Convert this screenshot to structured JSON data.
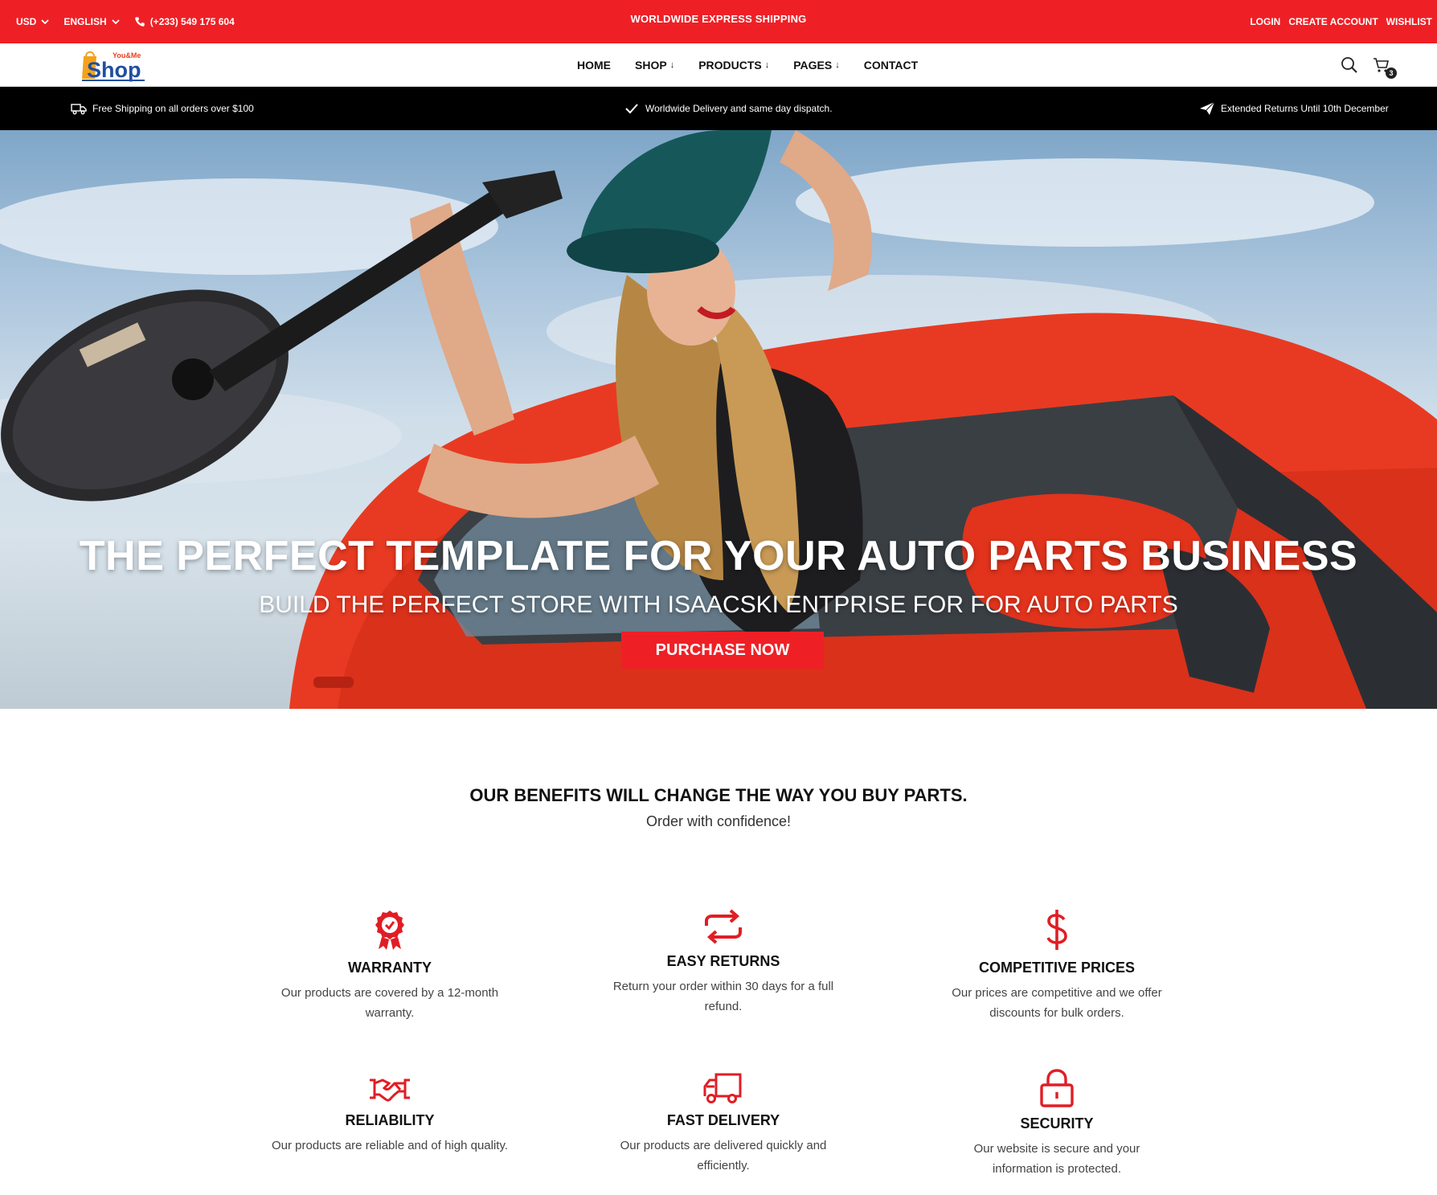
{
  "topbar": {
    "currency": "USD",
    "language": "ENGLISH",
    "phone": "(+233) 549 175 604",
    "announcement": "WORLDWIDE EXPRESS SHIPPING",
    "links": {
      "login": "LOGIN",
      "create_account": "CREATE ACCOUNT",
      "wishlist": "WISHLIST"
    }
  },
  "logo": {
    "top": "You&Me",
    "main": "Shop"
  },
  "nav": {
    "home": "HOME",
    "shop": "SHOP",
    "products": "PRODUCTS",
    "pages": "PAGES",
    "contact": "CONTACT",
    "arrow": "↓",
    "cart_count": "3"
  },
  "infobar": {
    "shipping": "Free Shipping on all orders over $100",
    "delivery": "Worldwide Delivery and same day dispatch.",
    "returns": "Extended Returns Until 10th December"
  },
  "hero": {
    "title": "THE PERFECT TEMPLATE FOR YOUR AUTO PARTS BUSINESS",
    "subtitle": "BUILD THE PERFECT STORE WITH ISAACSKI ENTPRISE FOR FOR AUTO PARTS",
    "button": "PURCHASE NOW"
  },
  "benefits": {
    "heading": "OUR BENEFITS WILL CHANGE THE WAY YOU BUY PARTS.",
    "subheading": "Order with confidence!",
    "items": [
      {
        "title": "WARRANTY",
        "text": "Our products are covered by a 12-month warranty.",
        "icon": "award-badge-icon"
      },
      {
        "title": "EASY RETURNS",
        "text": "Return your order within 30 days for a full refund.",
        "icon": "returns-arrows-icon"
      },
      {
        "title": "COMPETITIVE PRICES",
        "text": "Our prices are competitive and we offer discounts for bulk orders.",
        "icon": "dollar-icon"
      },
      {
        "title": "RELIABILITY",
        "text": "Our products are reliable and of high quality.",
        "icon": "handshake-icon"
      },
      {
        "title": "FAST DELIVERY",
        "text": "Our products are delivered quickly and efficiently.",
        "icon": "truck-icon"
      },
      {
        "title": "SECURITY",
        "text": "Our website is secure and your information is protected.",
        "icon": "lock-icon"
      }
    ]
  },
  "colors": {
    "accent": "#ee2026",
    "infobar": "#000000",
    "text": "#111111"
  }
}
